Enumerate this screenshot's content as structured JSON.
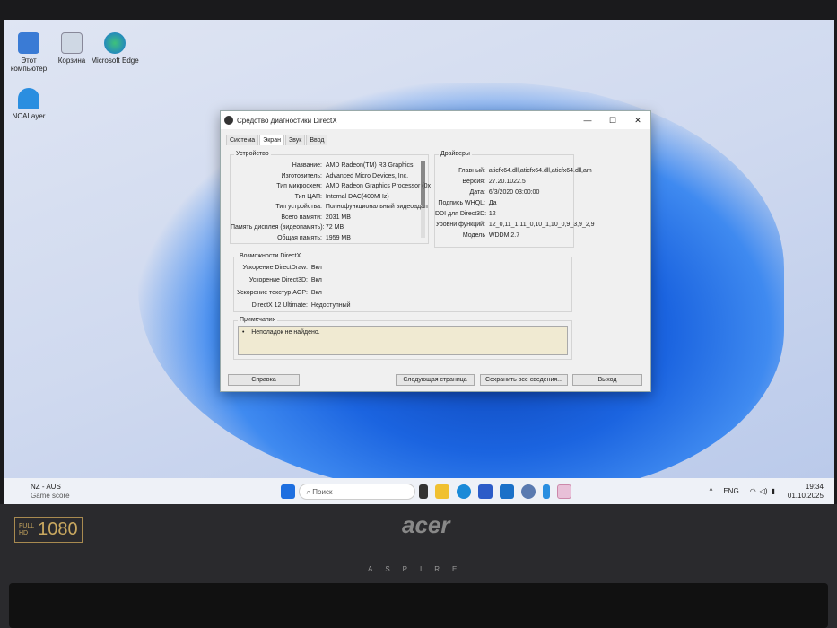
{
  "desktop": {
    "icons": [
      "Этот компьютер",
      "Корзина",
      "Microsoft Edge",
      "NCALayer"
    ]
  },
  "dialog": {
    "title": "Средство диагностики DirectX",
    "window_controls": [
      "—",
      "☐",
      "✕"
    ],
    "tabs": [
      "Система",
      "Экран",
      "Звук",
      "Ввод"
    ],
    "active_tab": "Экран",
    "device": {
      "label": "Устройство",
      "rows": [
        {
          "k": "Название:",
          "v": "AMD Radeon(TM) R3 Graphics"
        },
        {
          "k": "Изготовитель:",
          "v": "Advanced Micro Devices, Inc."
        },
        {
          "k": "Тип микросхем:",
          "v": "AMD Radeon Graphics Processor (0x"
        },
        {
          "k": "Тип ЦАП:",
          "v": "Internal DAC(400MHz)"
        },
        {
          "k": "Тип устройства:",
          "v": "Полнофункциональный видеоадап"
        },
        {
          "k": "Всего памяти:",
          "v": "2031 MB"
        },
        {
          "k": "Память дисплея (видеопамять):",
          "v": "72 MB"
        },
        {
          "k": "Общая память:",
          "v": "1959 MB"
        }
      ]
    },
    "drivers": {
      "label": "Драйверы",
      "rows": [
        {
          "k": "Главный:",
          "v": "aticfx64.dll,aticfx64.dll,aticfx64.dll,am"
        },
        {
          "k": "Версия:",
          "v": "27.20.1022.5"
        },
        {
          "k": "Дата:",
          "v": "6/3/2020 03:00:00"
        },
        {
          "k": "Подпись WHQL:",
          "v": "Да"
        },
        {
          "k": "DDI для Direct3D:",
          "v": "12"
        },
        {
          "k": "Уровни функций:",
          "v": "12_0,11_1,11_0,10_1,10_0,9_3,9_2,9"
        },
        {
          "k": "Модель",
          "v": "WDDM 2.7"
        }
      ]
    },
    "features": {
      "label": "Возможности DirectX",
      "rows": [
        {
          "k": "Ускорение DirectDraw:",
          "v": "Вкл"
        },
        {
          "k": "Ускорение Direct3D:",
          "v": "Вкл"
        },
        {
          "k": "Ускорение текстур AGP:",
          "v": "Вкл"
        },
        {
          "k": "DirectX 12 Ultimate:",
          "v": "Недоступный"
        }
      ]
    },
    "notes": {
      "label": "Примечания",
      "items": [
        "Неполадок не найдено."
      ]
    },
    "buttons": {
      "help": "Справка",
      "next": "Следующая страница",
      "save": "Сохранить все сведения...",
      "exit": "Выход"
    }
  },
  "taskbar": {
    "weather_title": "NZ - AUS",
    "weather_sub": "Game score",
    "search_placeholder": "Поиск",
    "lang": "ENG",
    "time": "19:34",
    "date": "01.10.2025"
  },
  "bezel": {
    "badge_full": "FULL",
    "badge_hd": "HD",
    "badge_res": "1080",
    "brand": "acer",
    "model": "ASPIRE"
  }
}
